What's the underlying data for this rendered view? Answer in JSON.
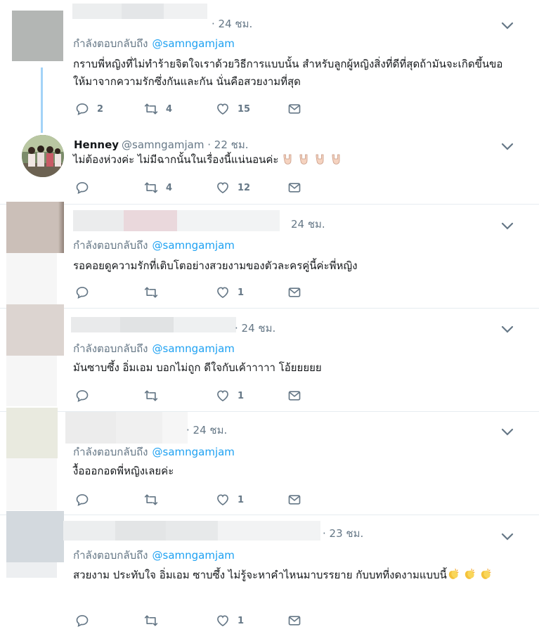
{
  "replying_prefix": "กำลังตอบกลับถึง",
  "tweets": [
    {
      "timestamp": "· 24 ชม.",
      "reply_handle": "@samngamjam",
      "text": "กราบพี่หญิงที่ไม่ทำร้ายจิตใจเราด้วยวิธีการแบบนั้น สำหรับลูกผู้หญิงสิ่งที่ดีที่สุดถ้ามันจะเกิดขึ้นขอให้มาจากความรักซึ่งกันและกัน นั่นคือสวยงามที่สุด",
      "replies": "2",
      "retweets": "4",
      "likes": "15"
    },
    {
      "name": "Henney",
      "handle": "@samngamjam",
      "timestamp": "· 22 ชม.",
      "text": "ไม่ต้องห่วงค่ะ ไม่มีฉากนั้นในเรื่องนี้แน่นอนค่ะ",
      "emoji_icons": [
        "love-you-gesture-icon",
        "love-you-gesture-icon",
        "love-you-gesture-icon",
        "love-you-gesture-icon"
      ],
      "replies": "",
      "retweets": "4",
      "likes": "12"
    },
    {
      "timestamp": "24 ชม.",
      "reply_handle": "@samngamjam",
      "text": "รอคอยดูความรักที่เติบโตอย่างสวยงามของตัวละครคู่นี้ค่ะพี่หญิง",
      "replies": "",
      "retweets": "",
      "likes": "1"
    },
    {
      "timestamp": "· 24 ชม.",
      "reply_handle": "@samngamjam",
      "text": "มันซาบซึ้ง อิ่มเอม บอกไม่ถูก  ดีใจกับเค้าาาาา โอ้ยยยยย",
      "replies": "",
      "retweets": "",
      "likes": "1"
    },
    {
      "timestamp": "· 24 ชม.",
      "reply_handle": "@samngamjam",
      "text": "งื้อออกอดพี่หญิงเลยค่ะ",
      "replies": "",
      "retweets": "",
      "likes": "1"
    },
    {
      "timestamp": "· 23 ชม.",
      "reply_handle": "@samngamjam",
      "text": "สวยงาม ประทับใจ อิ่มเอม ซาบซึ้ง ไม่รู้จะหาคำไหนมาบรรยาย กับบทที่งดงามแบบนี้",
      "emoji_icons": [
        "clapping-hands-icon",
        "clapping-hands-icon",
        "clapping-hands-icon"
      ],
      "replies": "",
      "retweets": "",
      "likes": "1"
    }
  ],
  "icons": {
    "reply": "reply-bubble-icon",
    "retweet": "retweet-icon",
    "like": "heart-icon",
    "dm": "envelope-icon",
    "more": "chevron-down-icon"
  },
  "colors": {
    "link": "#1da1f2",
    "meta": "#657786",
    "text": "#14171a",
    "thread_line": "#a3d3f7",
    "divider": "#e6ecf0"
  }
}
